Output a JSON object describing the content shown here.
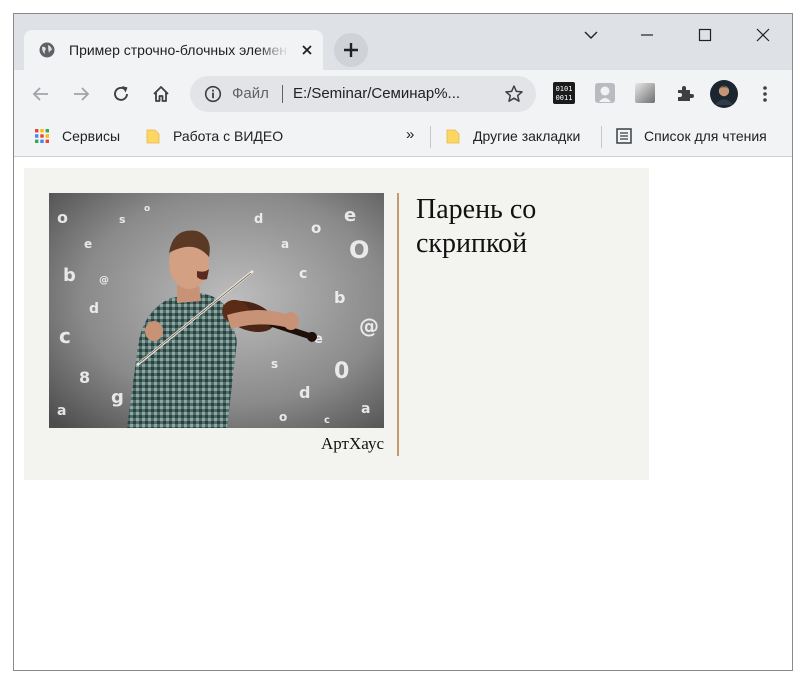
{
  "tab": {
    "title": "Пример строчно-блочных элементов"
  },
  "omnibox": {
    "security_label": "Файл",
    "url": "E:/Seminar/Семинар%..."
  },
  "bookmarks": {
    "items": [
      {
        "label": "Сервисы"
      },
      {
        "label": "Работа с ВИДЕО"
      }
    ],
    "overflow": "»",
    "other": "Другие закладки",
    "reading_list": "Список для чтения"
  },
  "page": {
    "figure_caption": "АртХаус",
    "heading": "Парень со скрипкой"
  },
  "colors": {
    "tabstrip": "#dee1e6",
    "toolbar": "#f1f3f4",
    "card_bg": "#f3f4f0",
    "divider_accent": "#c59a6b"
  }
}
